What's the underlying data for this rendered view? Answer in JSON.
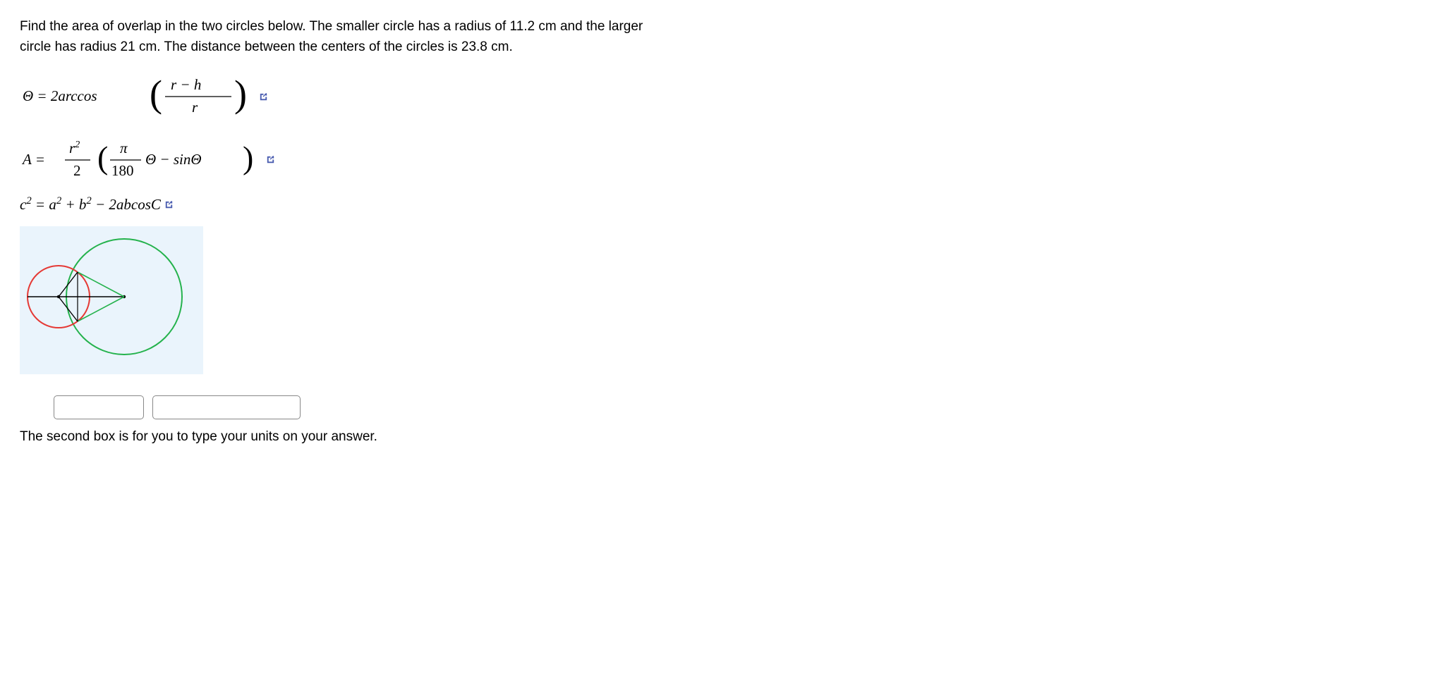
{
  "problem": {
    "line1": "Find the area of overlap in the two circles below.  The smaller circle has a radius of 11.2 cm and the larger",
    "line2": "circle has radius 21 cm.  The distance between the centers of the circles is 23.8 cm."
  },
  "formulas": {
    "theta": {
      "lhs": "Θ = 2arccos",
      "num": "r − h",
      "den": "r"
    },
    "area": {
      "lhs1": "A =",
      "frac1num": "r",
      "frac1numexp": "2",
      "frac1den": "2",
      "frac2num": "π",
      "frac2den": "180",
      "mid": "Θ − sinΘ"
    },
    "cos_law": {
      "text": "c² = a² + b² − 2abcosC"
    }
  },
  "inputs": {
    "answer_value": "",
    "answer_placeholder": "",
    "units_value": "",
    "units_placeholder": ""
  },
  "hint": "The second box is for you to type your units on your answer.",
  "colors": {
    "diagram_bg": "#eaf4fc",
    "small_circle": "#e53935",
    "large_circle": "#24b24c",
    "chord": "#24b24c",
    "line": "#000",
    "popout": "#4a5db0"
  }
}
